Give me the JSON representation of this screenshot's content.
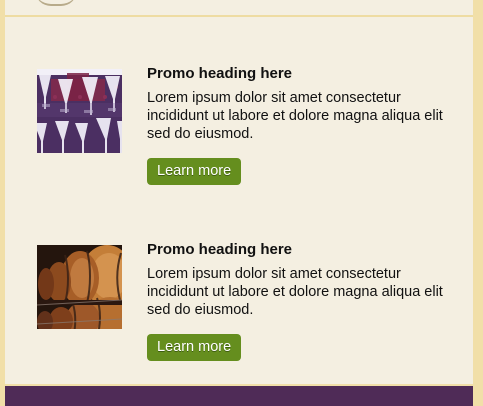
{
  "colors": {
    "frame": "#f1dfa8",
    "panel_background": "#f4efe1",
    "button": "#658e1e",
    "footer": "#4f2b57"
  },
  "header": {
    "logo_icon": "winery-logo-icon"
  },
  "promos": [
    {
      "heading": "Promo heading here",
      "body": "Lorem ipsum dolor sit amet consectetur incididunt ut labore et dolore magna aliqua elit sed do eiusmod.",
      "button_label": "Learn more",
      "image_icon": "wine-glasses-image"
    },
    {
      "heading": "Promo heading here",
      "body": "Lorem ipsum dolor sit amet consectetur incididunt ut labore et dolore magna aliqua elit sed do eiusmod.",
      "button_label": "Learn more",
      "image_icon": "wine-barrels-image"
    }
  ]
}
